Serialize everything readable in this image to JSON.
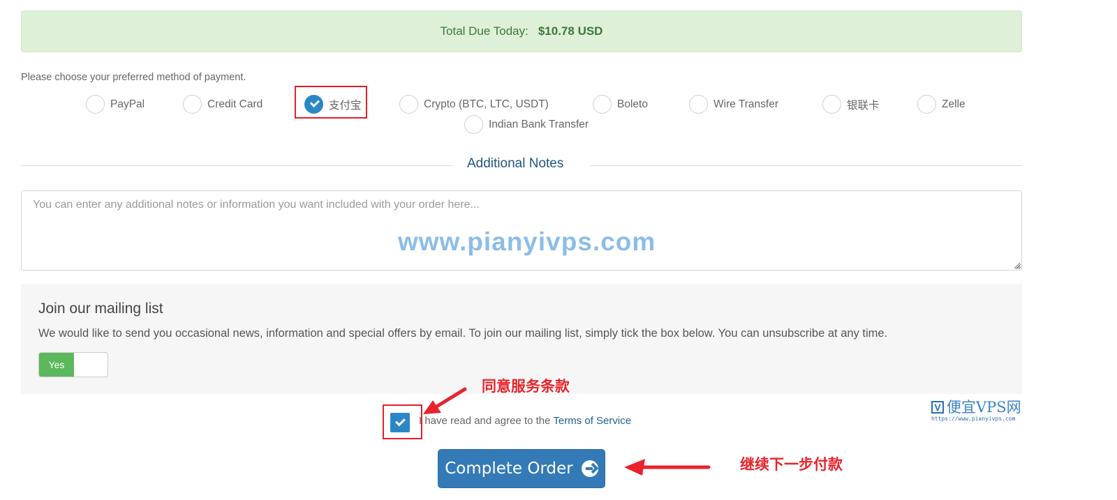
{
  "summary": {
    "total_label": "Total Due Today:",
    "total_amount": "$10.78 USD"
  },
  "payment": {
    "prompt": "Please choose your preferred method of payment.",
    "selected": "支付宝",
    "methods": [
      {
        "label": "PayPal",
        "checked": false
      },
      {
        "label": "Credit Card",
        "checked": false
      },
      {
        "label": "支付宝",
        "checked": true
      },
      {
        "label": "Crypto (BTC, LTC, USDT)",
        "checked": false
      },
      {
        "label": "Boleto",
        "checked": false
      },
      {
        "label": "Wire Transfer",
        "checked": false
      },
      {
        "label": "银联卡",
        "checked": false
      },
      {
        "label": "Zelle",
        "checked": false
      },
      {
        "label": "Indian Bank Transfer",
        "checked": false
      }
    ]
  },
  "notes": {
    "title": "Additional Notes",
    "value": "",
    "placeholder": "You can enter any additional notes or information you want included with your order here..."
  },
  "watermark": {
    "text": "www.pianyivps.com"
  },
  "mailing_list": {
    "title": "Join our mailing list",
    "description": "We would like to send you occasional news, information and special offers by email. To join our mailing list, simply tick the box below. You can unsubscribe at any time.",
    "toggle_label": "Yes",
    "toggle_on": true
  },
  "terms": {
    "checked": true,
    "text": "I have read and agree to the ",
    "link_text": "Terms of Service"
  },
  "actions": {
    "complete_order_label": "Complete Order"
  },
  "annotations": {
    "agree_terms": "同意服务条款",
    "continue_payment": "继续下一步付款",
    "highlight_color": "#e0202a"
  },
  "brand": {
    "logo_letter": "V",
    "name": "便宜VPS网",
    "url": "https://www.pianyivps.com"
  },
  "colors": {
    "primary": "#337ab7",
    "success_bg": "#dff0d8",
    "success_text": "#3c763d",
    "toggle_on": "#5cb85c",
    "checked": "#2a87c5"
  }
}
